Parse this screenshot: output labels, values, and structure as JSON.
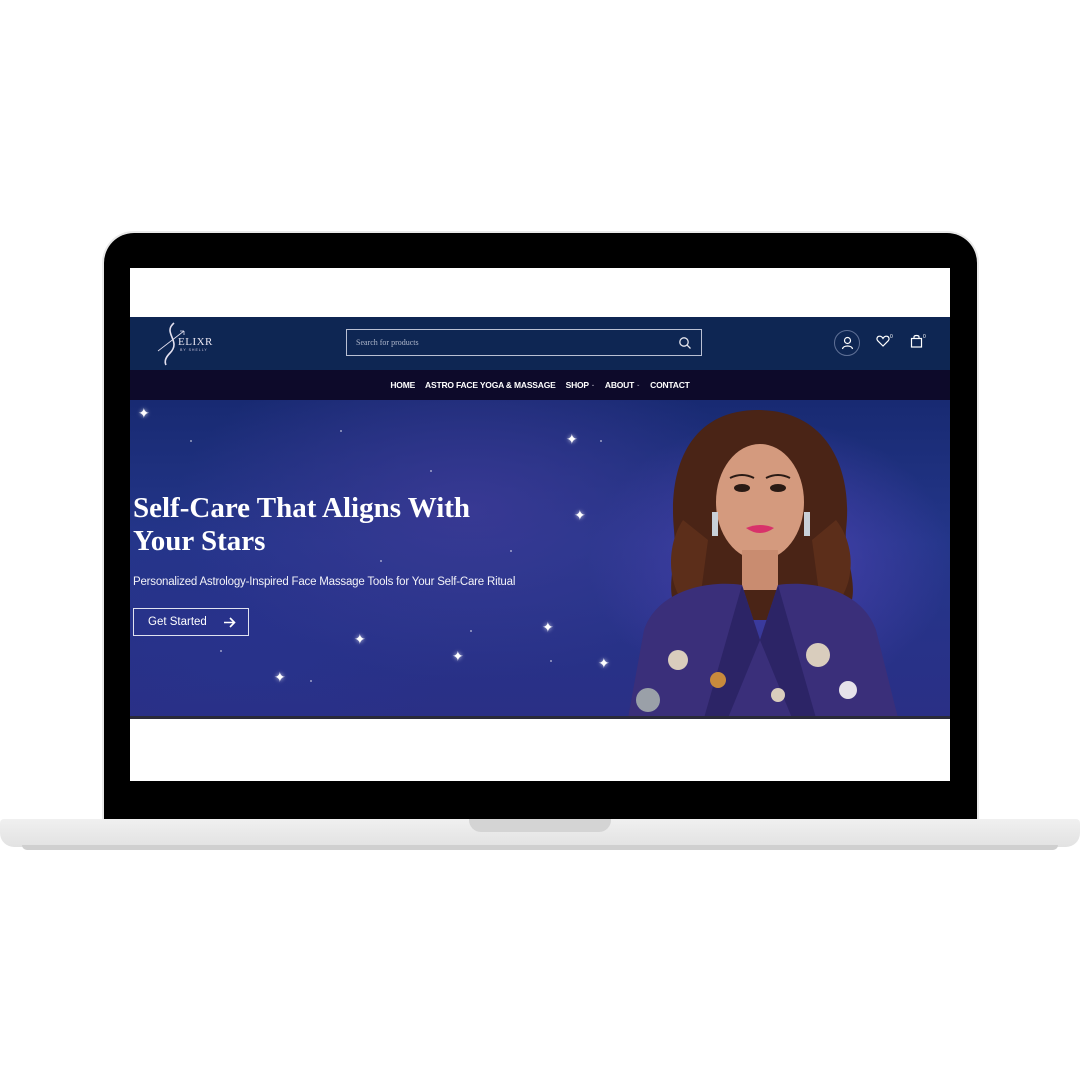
{
  "brand": {
    "logo_main": "ELIXR",
    "logo_sub": "BY SHELLY"
  },
  "search": {
    "placeholder": "Search for products"
  },
  "header_icons": {
    "wishlist_count": "0",
    "cart_count": "0"
  },
  "nav": {
    "items": [
      {
        "label": "HOME"
      },
      {
        "label": "ASTRO FACE YOGA & MASSAGE"
      },
      {
        "label": "SHOP"
      },
      {
        "label": "ABOUT"
      },
      {
        "label": "CONTACT"
      }
    ]
  },
  "hero": {
    "title_line1": "Self-Care That Aligns With",
    "title_line2": "Your Stars",
    "subtitle": "Personalized Astrology-Inspired Face Massage Tools for Your Self-Care Ritual",
    "cta_label": "Get Started"
  },
  "colors": {
    "header_bg": "#0e2653",
    "nav_bg": "#0d0a2a",
    "hero_bg": "#24368a"
  }
}
